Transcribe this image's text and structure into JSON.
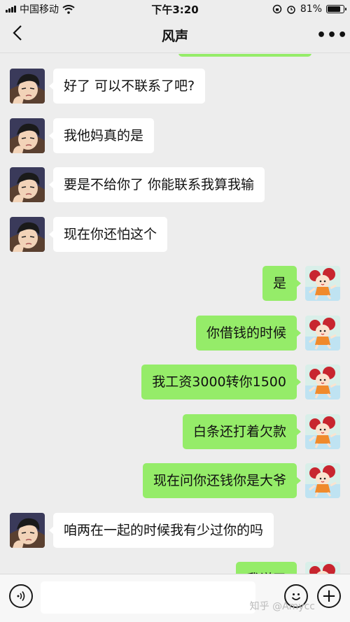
{
  "status_bar": {
    "carrier": "中国移动",
    "time": "下午3:20",
    "battery": "81%",
    "battery_level": 0.81
  },
  "header": {
    "back_icon": "chevron-left-icon",
    "title": "风声",
    "more_icon": "more-dots-icon",
    "more_label": "•••"
  },
  "messages": [
    {
      "side": "left",
      "text": "好了 可以不联系了吧?"
    },
    {
      "side": "left",
      "text": "我他妈真的是"
    },
    {
      "side": "left",
      "text": "要是不给你了 你能联系我算我输"
    },
    {
      "side": "left",
      "text": "现在你还怕这个"
    },
    {
      "side": "right",
      "text": "是"
    },
    {
      "side": "right",
      "text": "你借钱的时候"
    },
    {
      "side": "right",
      "text": "我工资3000转你1500"
    },
    {
      "side": "right",
      "text": "白条还打着欠款"
    },
    {
      "side": "right",
      "text": "现在问你还钱你是大爷"
    },
    {
      "side": "left",
      "text": "咱两在一起的时候我有少过你的吗"
    },
    {
      "side": "right",
      "text": "我说了"
    }
  ],
  "input_bar": {
    "voice_icon": "voice-icon",
    "emoji_icon": "emoji-icon",
    "plus_icon": "plus-icon",
    "plus_label": "+",
    "watermark": "知乎 @Amycc"
  },
  "colors": {
    "background": "#ededed",
    "sent_bubble": "#95ec69",
    "received_bubble": "#ffffff"
  }
}
